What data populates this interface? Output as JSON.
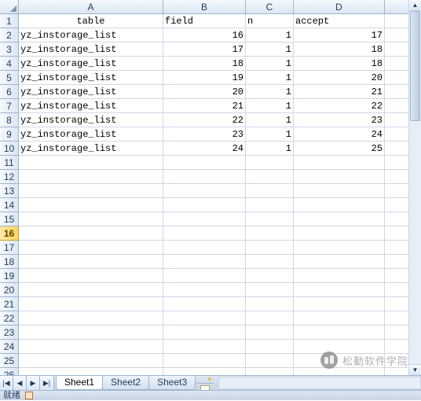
{
  "columns": [
    "A",
    "B",
    "C",
    "D",
    ""
  ],
  "headers": {
    "A": "table",
    "B": "field",
    "C": "n",
    "D": "accept"
  },
  "rows": [
    {
      "A": "yz_instorage_list",
      "B": "16",
      "C": "1",
      "D": "17"
    },
    {
      "A": "yz_instorage_list",
      "B": "17",
      "C": "1",
      "D": "18"
    },
    {
      "A": "yz_instorage_list",
      "B": "18",
      "C": "1",
      "D": "18"
    },
    {
      "A": "yz_instorage_list",
      "B": "19",
      "C": "1",
      "D": "20"
    },
    {
      "A": "yz_instorage_list",
      "B": "20",
      "C": "1",
      "D": "21"
    },
    {
      "A": "yz_instorage_list",
      "B": "21",
      "C": "1",
      "D": "22"
    },
    {
      "A": "yz_instorage_list",
      "B": "22",
      "C": "1",
      "D": "23"
    },
    {
      "A": "yz_instorage_list",
      "B": "23",
      "C": "1",
      "D": "24"
    },
    {
      "A": "yz_instorage_list",
      "B": "24",
      "C": "1",
      "D": "25"
    }
  ],
  "total_visible_rows": 26,
  "selected_row": 16,
  "sheet_tabs": [
    "Sheet1",
    "Sheet2",
    "Sheet3"
  ],
  "active_sheet": 0,
  "status_text": "就绪",
  "watermark_text": "松勤软件学院",
  "nav_glyphs": [
    "|◀",
    "◀",
    "▶",
    "▶|"
  ]
}
